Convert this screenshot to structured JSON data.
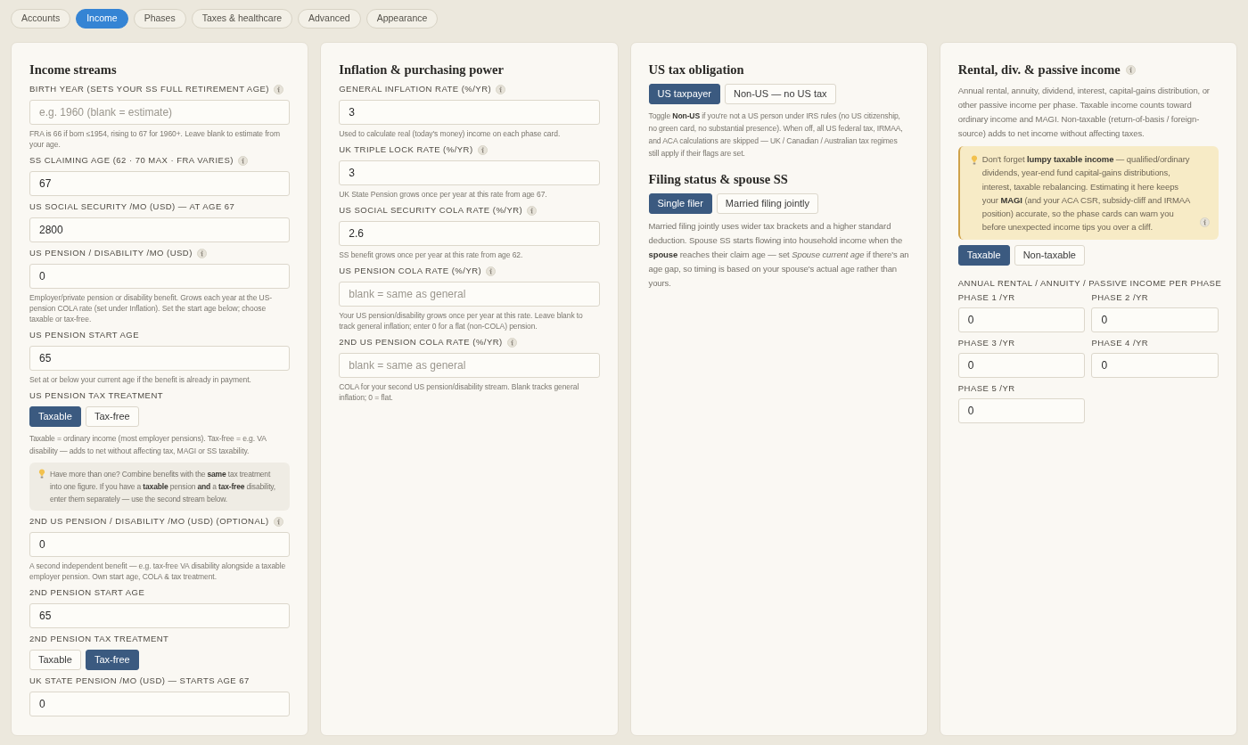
{
  "tabs": [
    {
      "label": "Accounts",
      "selected": false
    },
    {
      "label": "Income",
      "selected": true
    },
    {
      "label": "Phases",
      "selected": false
    },
    {
      "label": "Taxes & healthcare",
      "selected": false
    },
    {
      "label": "Advanced",
      "selected": false
    },
    {
      "label": "Appearance",
      "selected": false
    }
  ],
  "panels": [
    {
      "blocks": [
        {
          "kind": "heading",
          "text": "Income streams"
        },
        {
          "kind": "field",
          "label": "BIRTH YEAR (SETS YOUR SS FULL RETIREMENT AGE)",
          "info": true,
          "placeholder": "e.g. 1960 (blank = estimate)",
          "hint": "FRA is 66 if born ≤1954, rising to 67 for 1960+. Leave blank to estimate from your age."
        },
        {
          "kind": "field",
          "label": "SS CLAIMING AGE (62 · 70 MAX · FRA VARIES)",
          "info": true,
          "value": "67"
        },
        {
          "kind": "field",
          "label": "US SOCIAL SECURITY /MO (USD) — AT AGE 67",
          "value": "2800"
        },
        {
          "kind": "field",
          "label": "US PENSION / DISABILITY /MO (USD)",
          "info": true,
          "value": "0",
          "hint": "Employer/private pension or disability benefit. Grows each year at the US-pension COLA rate (set under Inflation). Set the start age below; choose taxable or tax-free."
        },
        {
          "kind": "field",
          "label": "US PENSION START AGE",
          "value": "65",
          "hint": "Set at or below your current age if the benefit is already in payment."
        },
        {
          "kind": "toggle",
          "label": "US PENSION TAX TREATMENT",
          "options": [
            {
              "label": "Taxable",
              "selected": true
            },
            {
              "label": "Tax-free",
              "selected": false
            }
          ],
          "hint": "Taxable = ordinary income (most employer pensions). Tax-free = e.g. VA disability — adds to net without affecting tax, MAGI or SS taxability."
        },
        {
          "kind": "note",
          "text": "Have more than one? Combine benefits with the **same** tax treatment into one figure. If you have a **taxable** pension **and** a **tax-free** disability, enter them separately — use the second stream below."
        },
        {
          "kind": "field",
          "label": "2ND US PENSION / DISABILITY /MO (USD) (OPTIONAL)",
          "info": true,
          "value": "0",
          "hint": "A second independent benefit — e.g. tax-free VA disability alongside a taxable employer pension. Own start age, COLA & tax treatment."
        },
        {
          "kind": "field",
          "label": "2ND PENSION START AGE",
          "value": "65"
        },
        {
          "kind": "toggle",
          "label": "2ND PENSION TAX TREATMENT",
          "options": [
            {
              "label": "Taxable",
              "selected": false
            },
            {
              "label": "Tax-free",
              "selected": true
            }
          ]
        },
        {
          "kind": "field",
          "label": "UK STATE PENSION /MO (USD) — STARTS AGE 67",
          "value": "0"
        }
      ]
    },
    {
      "blocks": [
        {
          "kind": "heading",
          "text": "Inflation & purchasing power"
        },
        {
          "kind": "field",
          "label": "GENERAL INFLATION RATE (%/YR)",
          "info": true,
          "value": "3",
          "hint": "Used to calculate real (today's money) income on each phase card."
        },
        {
          "kind": "field",
          "label": "UK TRIPLE LOCK RATE (%/YR)",
          "info": true,
          "value": "3",
          "hint": "UK State Pension grows once per year at this rate from age 67."
        },
        {
          "kind": "field",
          "label": "US SOCIAL SECURITY COLA RATE (%/YR)",
          "info": true,
          "value": "2.6",
          "hint": "SS benefit grows once per year at this rate from age 62."
        },
        {
          "kind": "field",
          "label": "US PENSION COLA RATE (%/YR)",
          "info": true,
          "placeholder": "blank = same as general",
          "hint": "Your US pension/disability grows once per year at this rate. Leave blank to track general inflation; enter 0 for a flat (non-COLA) pension."
        },
        {
          "kind": "field",
          "label": "2ND US PENSION COLA RATE (%/YR)",
          "info": true,
          "placeholder": "blank = same as general",
          "hint": "COLA for your second US pension/disability stream. Blank tracks general inflation; 0 = flat."
        }
      ]
    },
    {
      "blocks": [
        {
          "kind": "heading",
          "text": "US tax obligation"
        },
        {
          "kind": "toggle",
          "options": [
            {
              "label": "US taxpayer",
              "selected": true
            },
            {
              "label": "Non-US — no US tax",
              "selected": false
            }
          ],
          "hint": "Toggle **Non-US** if you're not a US person under IRS rules (no US citizenship, no green card, no substantial presence). When off, all US federal tax, IRMAA, and ACA calculations are skipped — UK / Canadian / Australian tax regimes still apply if their flags are set."
        },
        {
          "kind": "heading",
          "text": "Filing status & spouse SS"
        },
        {
          "kind": "toggle",
          "options": [
            {
              "label": "Single filer",
              "selected": true
            },
            {
              "label": "Married filing jointly",
              "selected": false
            }
          ]
        },
        {
          "kind": "paragraph",
          "text": "Married filing jointly uses wider tax brackets and a higher standard deduction. Spouse SS starts flowing into household income when the **spouse** reaches their claim age — set *Spouse current age* if there's an age gap, so timing is based on your spouse's actual age rather than yours."
        }
      ]
    },
    {
      "blocks": [
        {
          "kind": "heading",
          "text": "Rental, div. & passive income",
          "info": true
        },
        {
          "kind": "paragraph",
          "text": "Annual rental, annuity, dividend, interest, capital-gains distribution, or other passive income per phase. Taxable income counts toward ordinary income and MAGI. Non-taxable (return-of-basis / foreign-source) adds to net income without affecting taxes."
        },
        {
          "kind": "callout",
          "info": true,
          "text": "Don't forget **lumpy taxable income** — qualified/ordinary dividends, year-end fund capital-gains distributions, interest, taxable rebalancing. Estimating it here keeps your **MAGI** (and your ACA CSR, subsidy-cliff and IRMAA position) accurate, so the phase cards can warn you before unexpected income tips you over a cliff."
        },
        {
          "kind": "toggle",
          "options": [
            {
              "label": "Taxable",
              "selected": true
            },
            {
              "label": "Non-taxable",
              "selected": false
            }
          ]
        },
        {
          "kind": "phase_grid",
          "label": "ANNUAL RENTAL / ANNUITY / PASSIVE INCOME PER PHASE",
          "fields": [
            {
              "label": "PHASE 1 /YR",
              "value": "0"
            },
            {
              "label": "PHASE 2 /YR",
              "value": "0"
            },
            {
              "label": "PHASE 3 /YR",
              "value": "0"
            },
            {
              "label": "PHASE 4 /YR",
              "value": "0"
            },
            {
              "label": "PHASE 5 /YR",
              "value": "0"
            }
          ]
        }
      ]
    }
  ]
}
